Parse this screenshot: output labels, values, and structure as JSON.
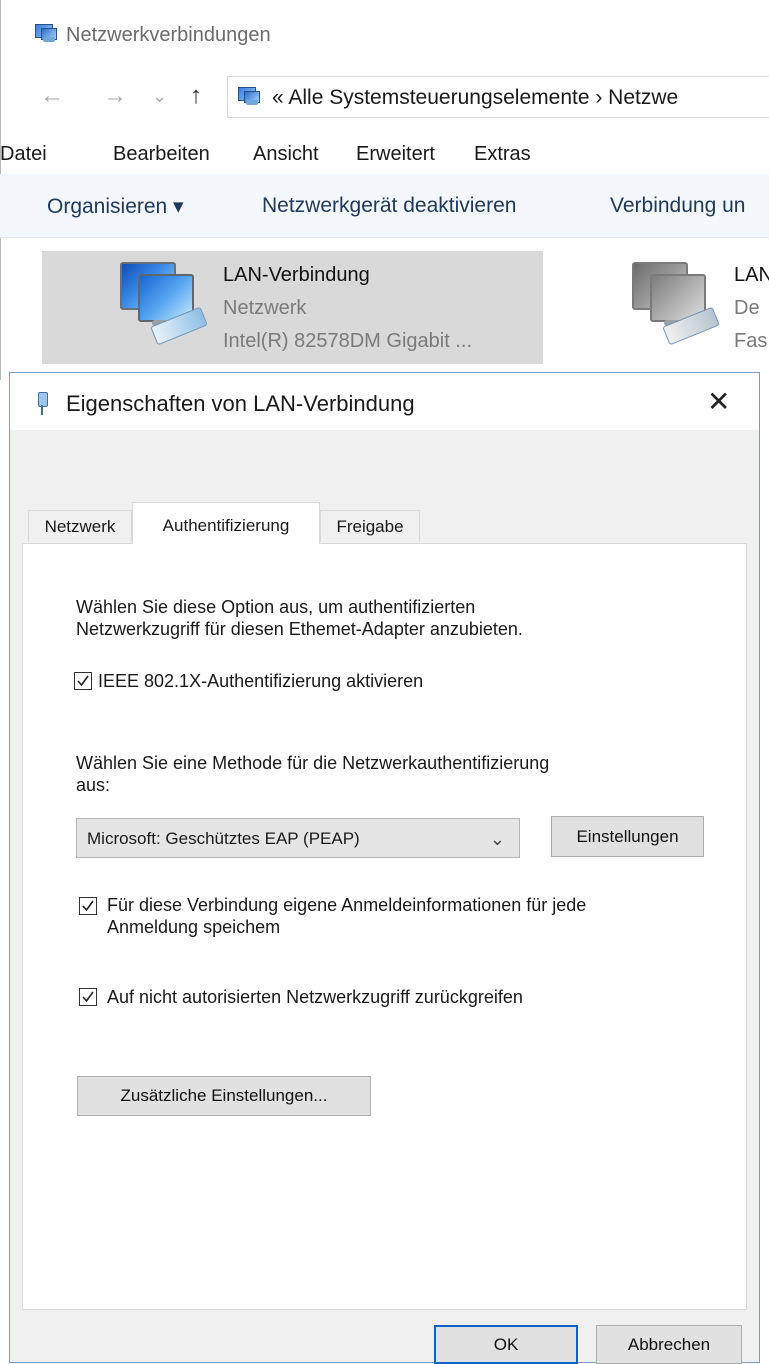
{
  "explorer": {
    "title": "Netzwerkverbindungen",
    "nav": {
      "back": "←",
      "forward": "→",
      "recent": "⌄",
      "up": "↑"
    },
    "address": "« Alle Systemsteuerungselemente › Netzwe",
    "menu": [
      "Datei",
      "Bearbeiten",
      "Ansicht",
      "Erweitert",
      "Extras"
    ],
    "toolbar": {
      "organize": "Organisieren ▾",
      "disable": "Netzwerkgerät deaktivieren",
      "connect": "Verbindung un"
    },
    "items": [
      {
        "name": "LAN-Verbindung",
        "status": "Netzwerk",
        "device": "Intel(R) 82578DM Gigabit ..."
      },
      {
        "name": "LAN",
        "status": "De",
        "device": "Fas"
      }
    ]
  },
  "dialog": {
    "title": "Eigenschaften von LAN-Verbindung",
    "close": "✕",
    "tabs": [
      "Netzwerk",
      "Authentifizierung",
      "Freigabe"
    ],
    "intro": "Wählen Sie diese Option aus, um authentifizierten Netzwerkzugriff für diesen Ethernet-Adapter anzubieten.",
    "intro_line1": "Wählen Sie diese Option aus, um authentifizierten",
    "intro_line2": "Netzwerkzugriff für diesen Ethemet-Adapter anzubieten.",
    "enable_8021x": {
      "label": "IEEE 802.1X-Authentifizierung aktivieren",
      "checked": true
    },
    "method_label_line1": "Wählen Sie eine Methode für die Netzwerkauthentifizierung",
    "method_label_line2": "aus:",
    "method_select": "Microsoft: Geschütztes EAP (PEAP)",
    "settings_button": "Einstellungen",
    "remember_line1": "Für diese Verbindung eigene Anmeldeinformationen für jede",
    "remember_line2": "Anmeldung speichem",
    "remember_checked": true,
    "fallback": {
      "label": "Auf nicht autorisierten Netzwerkzugriff zurückgreifen",
      "checked": true
    },
    "additional_button": "Zusätzliche Einstellungen...",
    "ok": "OK",
    "cancel": "Abbrechen"
  }
}
